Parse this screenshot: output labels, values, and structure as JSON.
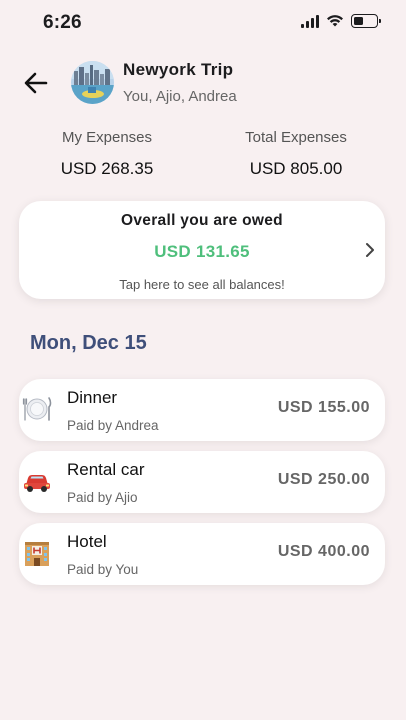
{
  "status_bar": {
    "time": "6:26"
  },
  "header": {
    "title": "Newyork Trip",
    "members": "You, Ajio, Andrea"
  },
  "summary": {
    "my_expenses_label": "My Expenses",
    "my_expenses_value": "USD 268.35",
    "total_expenses_label": "Total Expenses",
    "total_expenses_value": "USD 805.00"
  },
  "owed_card": {
    "title": "Overall you are owed",
    "amount": "USD 131.65",
    "hint": "Tap here to see all balances!"
  },
  "date_header": "Mon, Dec 15",
  "expenses": [
    {
      "name": "Dinner",
      "payer": "Paid by Andrea",
      "amount": "USD 155.00",
      "icon": "dinner-plate-icon"
    },
    {
      "name": "Rental car",
      "payer": "Paid by Ajio",
      "amount": "USD 250.00",
      "icon": "car-icon"
    },
    {
      "name": "Hotel",
      "payer": "Paid by You",
      "amount": "USD 400.00",
      "icon": "hotel-icon"
    }
  ],
  "colors": {
    "background": "#f8f0f1",
    "owed_green": "#4fbf7c",
    "date_header": "#3f4f7a"
  }
}
